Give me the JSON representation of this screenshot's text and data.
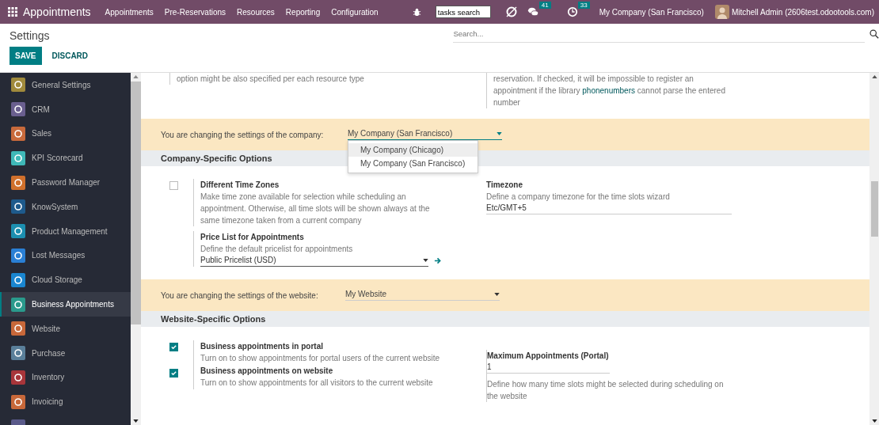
{
  "navbar": {
    "app_title": "Appointments",
    "menu": [
      "Appointments",
      "Pre-Reservations",
      "Resources",
      "Reporting",
      "Configuration"
    ],
    "search_value": "tasks search",
    "messages_count": "41",
    "activities_count": "33",
    "company": "My Company (San Francisco)",
    "user": "Mitchell Admin (2606test.odootools.com)"
  },
  "control_panel": {
    "title": "Settings",
    "search_placeholder": "Search...",
    "buttons": [
      {
        "label": "SAVE",
        "kind": "primary"
      },
      {
        "label": "DISCARD",
        "kind": "link"
      }
    ]
  },
  "sidebar": {
    "items": [
      {
        "label": "General Settings",
        "selected": false,
        "color": "#a08a3c"
      },
      {
        "label": "CRM",
        "selected": false,
        "color": "#6a5f8f"
      },
      {
        "label": "Sales",
        "selected": false,
        "color": "#c86a3c"
      },
      {
        "label": "KPI Scorecard",
        "selected": false,
        "color": "#3fb8b8"
      },
      {
        "label": "Password Manager",
        "selected": false,
        "color": "#d0702c"
      },
      {
        "label": "KnowSystem",
        "selected": false,
        "color": "#1e5a8c"
      },
      {
        "label": "Product Management",
        "selected": false,
        "color": "#1c8fb0"
      },
      {
        "label": "Lost Messages",
        "selected": false,
        "color": "#2a7fd4"
      },
      {
        "label": "Cloud Storage",
        "selected": false,
        "color": "#1a86d0"
      },
      {
        "label": "Business Appointments",
        "selected": true,
        "color": "#2a9a8c"
      },
      {
        "label": "Website",
        "selected": false,
        "color": "#c8683a"
      },
      {
        "label": "Purchase",
        "selected": false,
        "color": "#5a7f9a"
      },
      {
        "label": "Inventory",
        "selected": false,
        "color": "#a8353a"
      },
      {
        "label": "Invoicing",
        "selected": false,
        "color": "#c8683a"
      }
    ]
  },
  "top_fragment": {
    "left": "option might be also specified per each resource type",
    "right_before": "reservation. If checked, it will be impossible to register an appointment if the library",
    "right_link": "phonenumbers",
    "right_after": "cannot parse the entered number"
  },
  "company_banner": {
    "label": "You are changing the settings of the company:",
    "value": "My Company (San Francisco)",
    "options": [
      {
        "label": "My Company (Chicago)",
        "highlighted": true
      },
      {
        "label": "My Company (San Francisco)",
        "highlighted": false
      }
    ]
  },
  "company_section": {
    "heading": "Company-Specific Options",
    "rows": [
      {
        "left": {
          "kind": "checkbox",
          "checked": false,
          "title": "Different Time Zones",
          "description": "Make time zone available for selection while scheduling an appointment. Otherwise, all time slots will be shown always at the same timezone taken from a current company"
        },
        "right": {
          "kind": "field",
          "title": "Timezone",
          "description": "Define a company timezone for the time slots wizard",
          "value": "Etc/GMT+5"
        }
      },
      {
        "left": {
          "kind": "select",
          "title": "Price List for Appointments",
          "description": "Define the default pricelist for appointments",
          "value": "Public Pricelist (USD)"
        }
      }
    ]
  },
  "website_banner": {
    "label": "You are changing the settings of the website:",
    "value": "My Website"
  },
  "website_section": {
    "heading": "Website-Specific Options",
    "rows": [
      {
        "left": {
          "kind": "checkboxes",
          "items": [
            {
              "checked": true,
              "title": "Business appointments in portal",
              "description": "Turn on to show appointments for portal users of the current website"
            },
            {
              "checked": true,
              "title": "Business appointments on website",
              "description": "Turn on to show appointments for all visitors to the current website"
            }
          ]
        },
        "right": {
          "kind": "field_note",
          "title": "Maximum Appointments (Portal)",
          "value": "1",
          "description": "Define how many time slots might be selected during scheduling on the website"
        }
      }
    ]
  }
}
